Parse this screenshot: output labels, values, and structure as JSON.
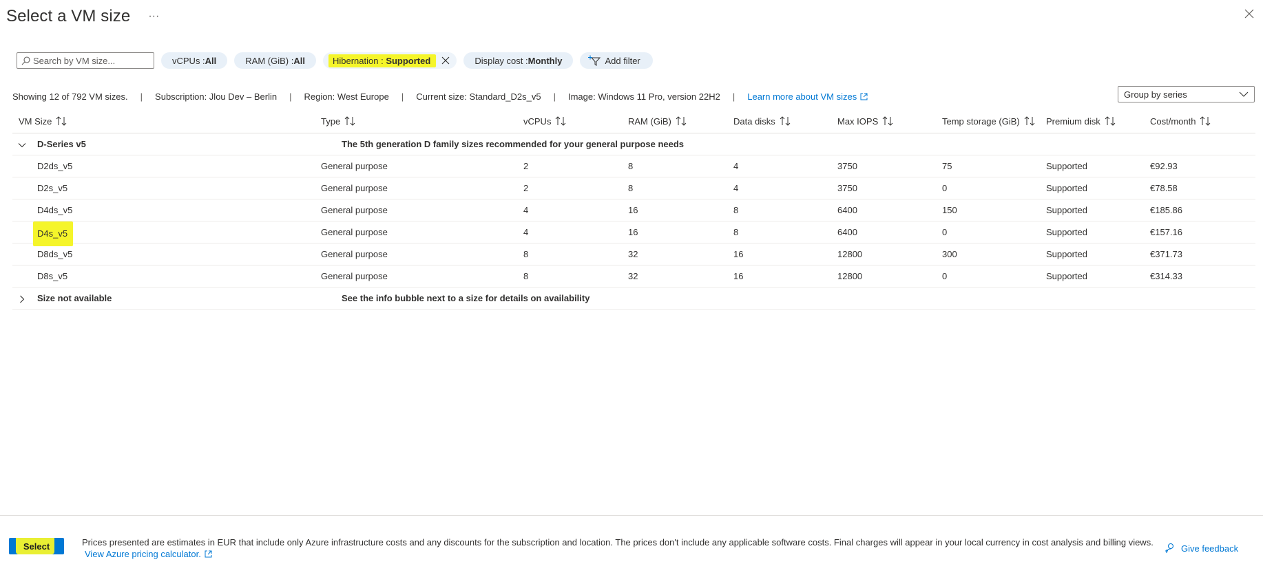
{
  "window": {
    "title": "Select a VM size",
    "more_label": "···"
  },
  "filters": {
    "search_placeholder": "Search by VM size...",
    "vcpus": {
      "label": "vCPUs : ",
      "value": "All"
    },
    "ram": {
      "label": "RAM (GiB) : ",
      "value": "All"
    },
    "hibernation": {
      "label": "Hibernation : ",
      "value": "Supported"
    },
    "display_cost": {
      "label": "Display cost : ",
      "value": "Monthly"
    },
    "add_filter_label": "Add filter"
  },
  "summary": {
    "showing": "Showing 12 of 792 VM sizes.",
    "subscription": "Subscription: Jlou Dev – Berlin",
    "region": "Region: West Europe",
    "current_size": "Current size: Standard_D2s_v5",
    "image": "Image: Windows 11 Pro, version 22H2",
    "learn_more": "Learn more about VM sizes",
    "separator": "|"
  },
  "group_by": {
    "value": "Group by series"
  },
  "table": {
    "columns": [
      "VM Size",
      "Type",
      "vCPUs",
      "RAM (GiB)",
      "Data disks",
      "Max IOPS",
      "Temp storage (GiB)",
      "Premium disk",
      "Cost/month"
    ],
    "group": {
      "name": "D-Series v5",
      "description": "The 5th generation D family sizes recommended for your general purpose needs"
    },
    "rows": [
      [
        "D2ds_v5",
        "General purpose",
        "2",
        "8",
        "4",
        "3750",
        "75",
        "Supported",
        "€92.93"
      ],
      [
        "D2s_v5",
        "General purpose",
        "2",
        "8",
        "4",
        "3750",
        "0",
        "Supported",
        "€78.58"
      ],
      [
        "D4ds_v5",
        "General purpose",
        "4",
        "16",
        "8",
        "6400",
        "150",
        "Supported",
        "€185.86"
      ],
      [
        "D4s_v5",
        "General purpose",
        "4",
        "16",
        "8",
        "6400",
        "0",
        "Supported",
        "€157.16"
      ],
      [
        "D8ds_v5",
        "General purpose",
        "8",
        "32",
        "16",
        "12800",
        "300",
        "Supported",
        "€371.73"
      ],
      [
        "D8s_v5",
        "General purpose",
        "8",
        "32",
        "16",
        "12800",
        "0",
        "Supported",
        "€314.33"
      ]
    ],
    "unavailable_group": {
      "name": "Size not available",
      "description": "See the info bubble next to a size for details on availability"
    }
  },
  "footer": {
    "select_label": "Select",
    "note_line1": "Prices presented are estimates in EUR that include only Azure infrastructure costs and any discounts for the subscription and location. The prices don't include any applicable software costs. Final charges will appear in your local currency in cost analysis and billing views.",
    "pricing_link": "View Azure pricing calculator.",
    "feedback_label": "Give feedback"
  },
  "colors": {
    "accent": "#0078d4",
    "highlight": "#f5f52a",
    "pill_bg": "#e8f0f8"
  },
  "icons": [
    "search-icon",
    "close-icon",
    "clear-filter-icon",
    "add-filter-icon",
    "external-link-icon",
    "chevron-down-icon",
    "chevron-right-icon",
    "sort-icon",
    "feedback-icon"
  ]
}
